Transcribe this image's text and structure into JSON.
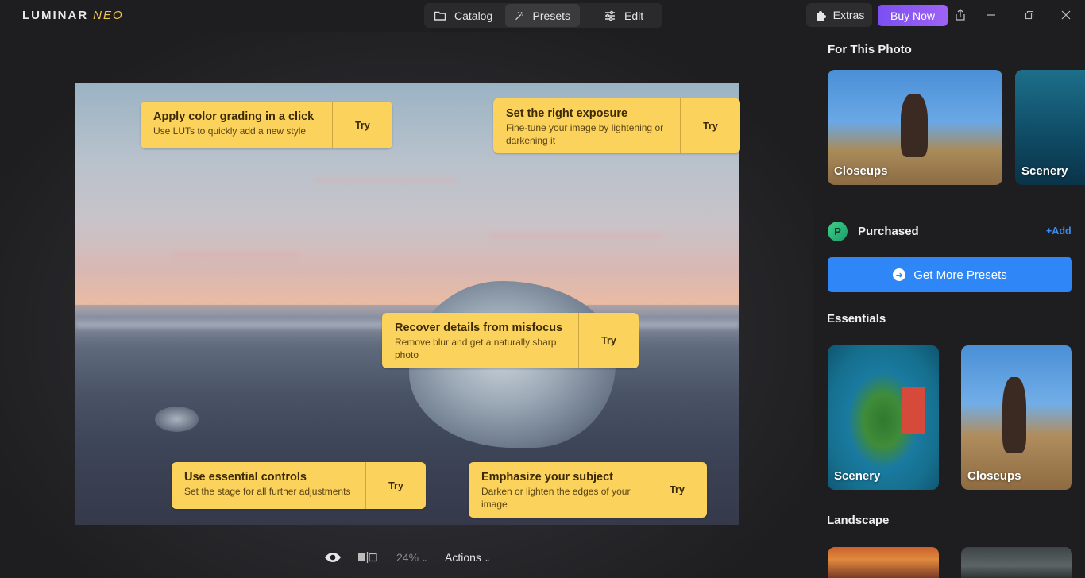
{
  "app": {
    "logo_main": "LUMINAR",
    "logo_sub": "NEO"
  },
  "nav": {
    "catalog": "Catalog",
    "presets": "Presets",
    "edit": "Edit",
    "active": "Presets"
  },
  "header": {
    "extras": "Extras",
    "buy_now": "Buy Now"
  },
  "tips": [
    {
      "title": "Apply color grading in a click",
      "desc": "Use LUTs to quickly add a new style",
      "action": "Try"
    },
    {
      "title": "Set the right exposure",
      "desc": "Fine-tune your image by lightening or darkening it",
      "action": "Try"
    },
    {
      "title": "Recover details from misfocus",
      "desc": "Remove blur and get a naturally sharp photo",
      "action": "Try"
    },
    {
      "title": "Use essential controls",
      "desc": "Set the stage for all further adjustments",
      "action": "Try"
    },
    {
      "title": "Emphasize your subject",
      "desc": "Darken or lighten the edges of your image",
      "action": "Try"
    }
  ],
  "toolbar": {
    "zoom": "24%",
    "actions": "Actions"
  },
  "panel": {
    "for_this_photo": {
      "title": "For This Photo",
      "cards": [
        {
          "label": "Closeups"
        },
        {
          "label": "Scenery"
        }
      ]
    },
    "purchased": {
      "icon_letter": "P",
      "title": "Purchased",
      "add": "+Add",
      "get_more": "Get More Presets"
    },
    "essentials": {
      "title": "Essentials",
      "cards": [
        {
          "label": "Scenery"
        },
        {
          "label": "Closeups"
        }
      ]
    },
    "landscape": {
      "title": "Landscape"
    }
  },
  "colors": {
    "accent": "#2f86f6",
    "buy": "#8b5cf6",
    "tip_bg": "#fbd25c"
  }
}
